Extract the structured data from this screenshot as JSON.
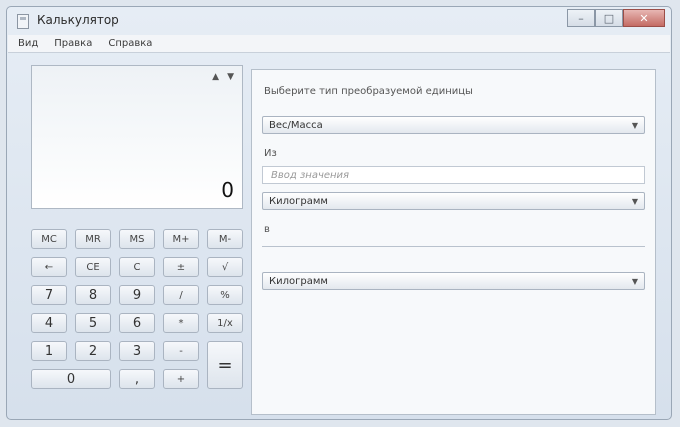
{
  "window": {
    "title": "Калькулятор",
    "controls": {
      "minimize": "–",
      "maximize": "□",
      "close": "✕"
    }
  },
  "menu": [
    "Вид",
    "Правка",
    "Справка"
  ],
  "display": {
    "value": "0",
    "arrows": [
      "▲",
      "▼"
    ]
  },
  "keys": {
    "memory": [
      "MC",
      "MR",
      "MS",
      "M+",
      "M-"
    ],
    "row1": [
      "←",
      "CE",
      "C",
      "±",
      "√"
    ],
    "row2": [
      "7",
      "8",
      "9",
      "/",
      "%"
    ],
    "row3": [
      "4",
      "5",
      "6",
      "*",
      "1/x"
    ],
    "row4": [
      "1",
      "2",
      "3",
      "-",
      "="
    ],
    "row5": [
      "0",
      ",",
      "+"
    ]
  },
  "converter": {
    "prompt": "Выберите тип преобразуемой единицы",
    "type": "Вес/Масса",
    "from_label": "Из",
    "input_placeholder": "Ввод значения",
    "from_unit": "Килограмм",
    "to_label": "в",
    "to_unit": "Килограмм"
  }
}
